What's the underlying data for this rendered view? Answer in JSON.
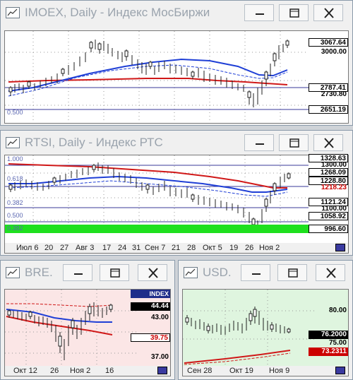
{
  "windows": [
    {
      "id": "imoex",
      "title": "IMOEX, Daily - Индекс МосБиржи",
      "price_labels": [
        {
          "text": "3067.64",
          "bg": "#ffffff",
          "fg": "#000000"
        },
        {
          "text": "3000.00",
          "bg": "transparent",
          "fg": "#000000"
        },
        {
          "text": "2787.41",
          "bg": "#ffffff",
          "fg": "#000000"
        },
        {
          "text": "2730.80",
          "bg": "transparent",
          "fg": "#000000"
        },
        {
          "text": "2651.19",
          "bg": "#ffffff",
          "fg": "#000000"
        }
      ],
      "fib_labels": [
        "0.500"
      ]
    },
    {
      "id": "rtsi",
      "title": "RTSI, Daily - Индекс РТС",
      "price_labels": [
        {
          "text": "1328.63",
          "bg": "#ffffff",
          "fg": "#000000"
        },
        {
          "text": "1300.00",
          "bg": "transparent",
          "fg": "#000000"
        },
        {
          "text": "1268.09",
          "bg": "#ffffff",
          "fg": "#000000"
        },
        {
          "text": "1228.80",
          "bg": "#ffffff",
          "fg": "#000000"
        },
        {
          "text": "1218.23",
          "bg": "transparent",
          "fg": "#cc0000"
        },
        {
          "text": "1121.24",
          "bg": "#ffffff",
          "fg": "#000000"
        },
        {
          "text": "1100.00",
          "bg": "transparent",
          "fg": "#000000"
        },
        {
          "text": "1058.92",
          "bg": "#ffffff",
          "fg": "#000000"
        },
        {
          "text": "996.60",
          "bg": "#ffffff",
          "fg": "#000000"
        }
      ],
      "fib_labels": [
        "1.000",
        "0.618",
        "0.382",
        "0.500",
        "0.382"
      ],
      "x_ticks": [
        "Июл 6",
        "20",
        "27",
        "Авг 3",
        "17",
        "24",
        "31",
        "Сен 7",
        "21",
        "28",
        "Окт 5",
        "19",
        "26",
        "Ноя 2"
      ]
    },
    {
      "id": "bre",
      "title": "BRE...",
      "header_tag": "INDEX",
      "price_labels": [
        {
          "text": "44.44",
          "bg": "#000000",
          "fg": "#ffffff"
        },
        {
          "text": "43.00",
          "bg": "transparent",
          "fg": "#000000"
        },
        {
          "text": "39.75",
          "bg": "#ffffff",
          "fg": "#cc0000"
        },
        {
          "text": "37.00",
          "bg": "transparent",
          "fg": "#000000"
        }
      ],
      "x_ticks": [
        "Окт 12",
        "26",
        "Ноя 2",
        "16"
      ]
    },
    {
      "id": "usd",
      "title": "USD...",
      "price_labels": [
        {
          "text": "80.00",
          "bg": "transparent",
          "fg": "#000000"
        },
        {
          "text": "76.2000",
          "bg": "#000000",
          "fg": "#ffffff"
        },
        {
          "text": "75.00",
          "bg": "transparent",
          "fg": "#000000"
        },
        {
          "text": "73.2311",
          "bg": "#cc0000",
          "fg": "#ffffff"
        }
      ],
      "x_ticks": [
        "Сен 28",
        "Окт 19",
        "Ноя 9"
      ]
    }
  ],
  "buttons": {
    "minimize": "—",
    "restore": "□",
    "close": "✕"
  },
  "colors": {
    "ma_blue": "#1f3fd6",
    "ma_red": "#d01818",
    "fib_line": "#3a3a9a",
    "volume_green": "#1ee01e"
  }
}
